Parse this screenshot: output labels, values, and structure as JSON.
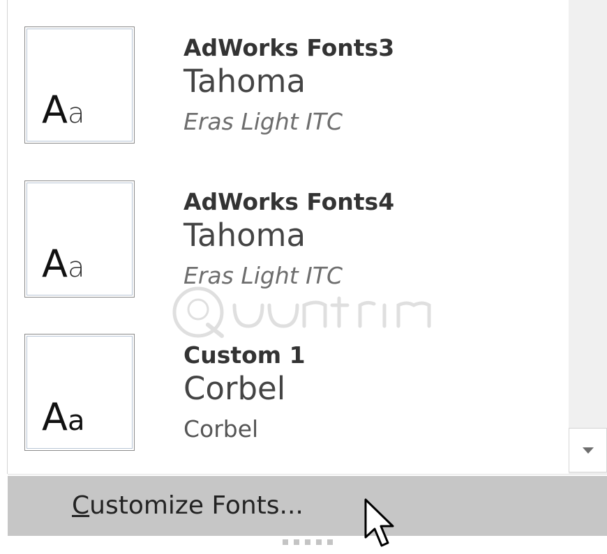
{
  "font_sets": [
    {
      "preview_big": "A",
      "preview_small": "a",
      "name": "AdWorks Fonts3",
      "heading_font": "Tahoma",
      "body_font": "Eras Light ITC"
    },
    {
      "preview_big": "A",
      "preview_small": "a",
      "name": "AdWorks Fonts4",
      "heading_font": "Tahoma",
      "body_font": "Eras Light ITC"
    },
    {
      "preview_big": "A",
      "preview_small": "a",
      "name": "Custom 1",
      "heading_font": "Corbel",
      "body_font": "Corbel"
    }
  ],
  "customize": {
    "mnemonic": "C",
    "rest": "ustomize Fonts..."
  },
  "scrollbar": {
    "down_icon": "chevron-down-icon"
  },
  "colors": {
    "menu_highlight": "#c6c6c6",
    "preview_border": "#8a8a8a",
    "scrollbar_track": "#f0f0f0"
  }
}
